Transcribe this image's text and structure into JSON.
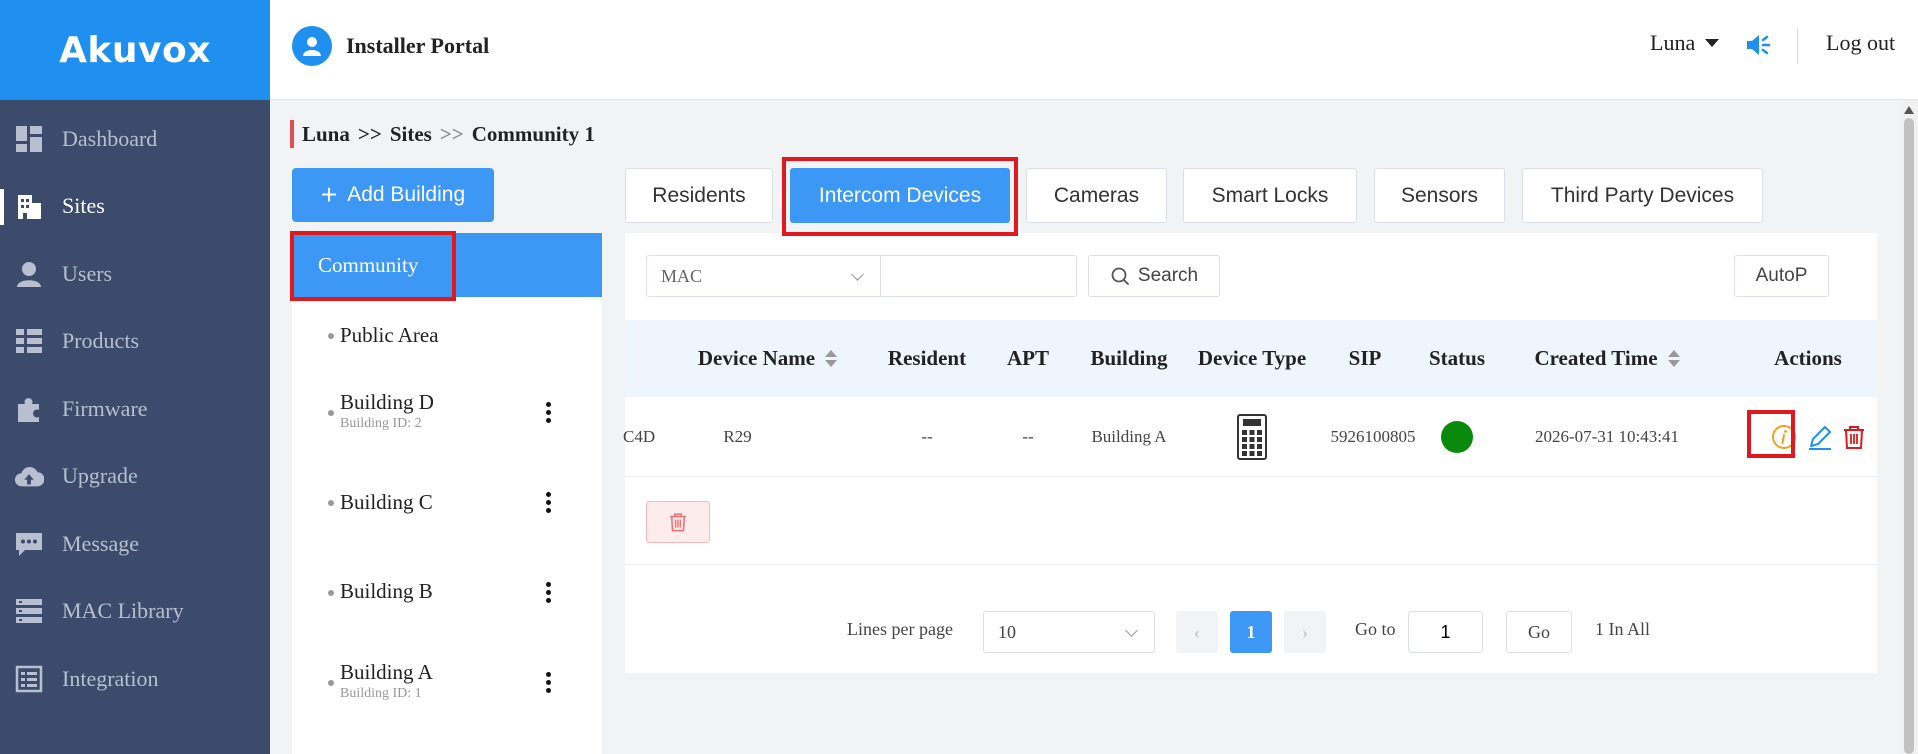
{
  "app": {
    "logo": "Akuvox",
    "portal_title": "Installer Portal"
  },
  "sidebar": {
    "items": [
      {
        "label": "Dashboard",
        "icon": "dashboard-icon",
        "active": false
      },
      {
        "label": "Sites",
        "icon": "building-icon",
        "active": true
      },
      {
        "label": "Users",
        "icon": "user-icon",
        "active": false
      },
      {
        "label": "Products",
        "icon": "list-icon",
        "active": false
      },
      {
        "label": "Firmware",
        "icon": "puzzle-icon",
        "active": false
      },
      {
        "label": "Upgrade",
        "icon": "cloud-upload-icon",
        "active": false
      },
      {
        "label": "Message",
        "icon": "chat-icon",
        "active": false
      },
      {
        "label": "MAC Library",
        "icon": "server-icon",
        "active": false
      },
      {
        "label": "Integration",
        "icon": "integration-icon",
        "active": false
      }
    ]
  },
  "header": {
    "user": "Luna",
    "logout": "Log out"
  },
  "breadcrumb": {
    "items": [
      "Luna",
      "Sites",
      "Community 1"
    ],
    "separator": ">>"
  },
  "buildings": {
    "add_label": "Add Building",
    "community_label": "Community",
    "items": [
      {
        "name": "Public Area",
        "sub": ""
      },
      {
        "name": "Building D",
        "sub": "Building ID: 2"
      },
      {
        "name": "Building C",
        "sub": ""
      },
      {
        "name": "Building B",
        "sub": ""
      },
      {
        "name": "Building A",
        "sub": "Building ID: 1"
      }
    ]
  },
  "tabs": [
    {
      "label": "Residents",
      "active": false
    },
    {
      "label": "Intercom Devices",
      "active": true
    },
    {
      "label": "Cameras",
      "active": false
    },
    {
      "label": "Smart Locks",
      "active": false
    },
    {
      "label": "Sensors",
      "active": false
    },
    {
      "label": "Third Party Devices",
      "active": false
    }
  ],
  "filter": {
    "field": "MAC",
    "value": "",
    "search_label": "Search",
    "autop_label": "AutoP"
  },
  "table": {
    "headers": [
      "Device Name",
      "Resident",
      "APT",
      "Building",
      "Device Type",
      "SIP",
      "Status",
      "Created Time",
      "Actions"
    ],
    "rows": [
      {
        "mac_partial": "C4D",
        "device_name": "R29",
        "resident": "--",
        "apt": "--",
        "building": "Building A",
        "device_type": "intercom-panel-icon",
        "sip": "5926100805",
        "status": "online",
        "created_time": "2026-07-31 10:43:41"
      }
    ]
  },
  "pagination": {
    "lines_label": "Lines per page",
    "lines_value": "10",
    "current_page": "1",
    "goto_label": "Go to",
    "goto_value": "1",
    "go_label": "Go",
    "total": "1 In All"
  },
  "colors": {
    "primary": "#3c97f5",
    "sidebar": "#3c4b6b",
    "logo_bg": "#1f8ff0",
    "highlight": "#e0191e",
    "status_online": "#0a8a0a",
    "danger": "#e0191e",
    "info": "#f0a020"
  }
}
